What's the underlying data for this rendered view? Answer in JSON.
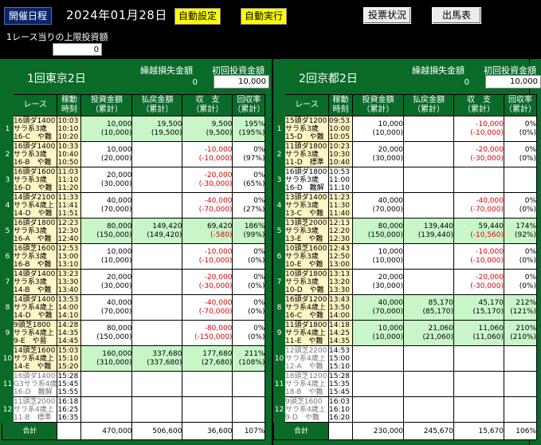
{
  "toolbar": {
    "schedule_label": "開催日程",
    "date": "2024年01月28日",
    "auto_setting": "自動設定",
    "auto_run": "自動実行",
    "vote_status": "投票状況",
    "race_card": "出馬表"
  },
  "limit": {
    "label": "1レース当りの上限投資額",
    "value": "0"
  },
  "venues": [
    {
      "name": "1回東京2日",
      "carry_label": "繰越損失金額",
      "carry_value": "0",
      "initial_label": "初回投資金額",
      "initial_value": "10,000",
      "headers": [
        "レース",
        "稼動\n時刻",
        "投資金額\n（累計）",
        "払戻金額\n（累計）",
        "収　支\n（累計）",
        "回収率\n（累計）"
      ],
      "rows": [
        {
          "no": "1",
          "race": [
            "16頭ダ1400",
            "サラ系3歳",
            "16-C　や難"
          ],
          "time": [
            "10:03",
            "10:10",
            "10:20"
          ],
          "inv": [
            "10,000",
            "(10,000)"
          ],
          "pay": [
            "19,500",
            "(19,500)"
          ],
          "bal": [
            "9,500",
            "(9,500)"
          ],
          "rate": [
            "195%",
            "(195%)"
          ],
          "state": "win"
        },
        {
          "no": "2",
          "race": [
            "16頭ダ1400",
            "サラ系3歳",
            "16-B　や難"
          ],
          "time": [
            "10:33",
            "10:40",
            "10:50"
          ],
          "inv": [
            "10,000",
            "(20,000)"
          ],
          "pay": [
            "",
            ""
          ],
          "bal": [
            "-10,000",
            "(-10,000)"
          ],
          "rate": [
            "0%",
            "(97%)"
          ],
          "state": "lose"
        },
        {
          "no": "3",
          "race": [
            "16頭ダ1600",
            "サラ系3歳",
            "16-D　や難"
          ],
          "time": [
            "11:03",
            "11:10",
            "11:20"
          ],
          "inv": [
            "20,000",
            "(30,000)"
          ],
          "pay": [
            "",
            ""
          ],
          "bal": [
            "-20,000",
            "(-30,000)"
          ],
          "rate": [
            "0%",
            "(65%)"
          ],
          "state": "lose"
        },
        {
          "no": "4",
          "race": [
            "14頭ダ2100",
            "サラ系4歳上",
            "14-D　や難"
          ],
          "time": [
            "11:33",
            "11:41",
            "11:51"
          ],
          "inv": [
            "40,000",
            "(70,000)"
          ],
          "pay": [
            "",
            ""
          ],
          "bal": [
            "-40,000",
            "(-70,000)"
          ],
          "rate": [
            "0%",
            "(27%)"
          ],
          "state": "lose"
        },
        {
          "no": "5",
          "race": [
            "16頭ダ1800",
            "サラ系3歳",
            "16-A　や難"
          ],
          "time": [
            "12:23",
            "12:30",
            "12:40"
          ],
          "inv": [
            "80,000",
            "(150,000)"
          ],
          "pay": [
            "149,420",
            "(149,420)"
          ],
          "bal": [
            "69,420",
            "(-580)"
          ],
          "rate": [
            "186%",
            "(99%)"
          ],
          "state": "win"
        },
        {
          "no": "6",
          "race": [
            "16頭芝1600",
            "サラ系3歳",
            "16-B　や難"
          ],
          "time": [
            "12:53",
            "13:00",
            "13:10"
          ],
          "inv": [
            "10,000",
            "(10,000)"
          ],
          "pay": [
            "",
            ""
          ],
          "bal": [
            "-10,000",
            "(-10,000)"
          ],
          "rate": [
            "0%",
            "(0%)"
          ],
          "state": "lose"
        },
        {
          "no": "7",
          "race": [
            "14頭ダ1400",
            "サラ系3歳",
            "14-B　や難"
          ],
          "time": [
            "13:23",
            "13:30",
            "13:40"
          ],
          "inv": [
            "20,000",
            "(30,000)"
          ],
          "pay": [
            "",
            ""
          ],
          "bal": [
            "-20,000",
            "(-30,000)"
          ],
          "rate": [
            "0%",
            "(0%)"
          ],
          "state": "lose"
        },
        {
          "no": "8",
          "race": [
            "14頭ダ1400",
            "サラ系4歳上",
            "14-D　や難"
          ],
          "time": [
            "13:53",
            "14:00",
            "14:10"
          ],
          "inv": [
            "40,000",
            "(70,000)"
          ],
          "pay": [
            "",
            ""
          ],
          "bal": [
            "-40,000",
            "(-70,000)"
          ],
          "rate": [
            "0%",
            "(0%)"
          ],
          "state": "lose"
        },
        {
          "no": "9",
          "race": [
            "9頭芝1800",
            "サラ系4歳上",
            "9-E　や易"
          ],
          "time": [
            "14:28",
            "14:35",
            "14:45"
          ],
          "inv": [
            "80,000",
            "(150,000)"
          ],
          "pay": [
            "",
            ""
          ],
          "bal": [
            "-80,000",
            "(-150,000)"
          ],
          "rate": [
            "0%",
            "(0%)"
          ],
          "state": "lose"
        },
        {
          "no": "10",
          "race": [
            "14頭芝1600",
            "サラ系4歳上",
            "14-E　や難"
          ],
          "time": [
            "15:03",
            "15:10",
            "15:20"
          ],
          "inv": [
            "160,000",
            "(310,000)"
          ],
          "pay": [
            "337,680",
            "(337,680)"
          ],
          "bal": [
            "177,680",
            "(27,680)"
          ],
          "rate": [
            "211%",
            "(108%)"
          ],
          "state": "win"
        },
        {
          "no": "11",
          "race": [
            "16頭ダ1400",
            "G3サラ系4歳",
            "16-D　難解"
          ],
          "time": [
            "15:28",
            "15:45",
            "15:55"
          ],
          "inv": [
            "",
            ""
          ],
          "pay": [
            "",
            ""
          ],
          "bal": [
            "",
            ""
          ],
          "rate": [
            "",
            ""
          ],
          "state": "past"
        },
        {
          "no": "12",
          "race": [
            "11頭芝2000",
            "サラ系4歳上",
            "11-B　標準"
          ],
          "time": [
            "16:18",
            "16:25",
            "16:35"
          ],
          "inv": [
            "",
            ""
          ],
          "pay": [
            "",
            ""
          ],
          "bal": [
            "",
            ""
          ],
          "rate": [
            "",
            ""
          ],
          "state": "past"
        }
      ],
      "total": {
        "label": "合計",
        "inv": "470,000",
        "pay": "506,600",
        "bal": "36,600",
        "rate": "107%"
      }
    },
    {
      "name": "2回京都2日",
      "carry_label": "繰越損失金額",
      "carry_value": "0",
      "initial_label": "初回投資金額",
      "initial_value": "10,000",
      "headers": [
        "レース",
        "稼動\n時刻",
        "投資金額\n（累計）",
        "払戻金額\n（累計）",
        "収　支\n（累計）",
        "回収率\n（累計）"
      ],
      "rows": [
        {
          "no": "1",
          "race": [
            "15頭ダ1200",
            "サラ系3歳",
            "15-D　や難"
          ],
          "time": [
            "09:53",
            "10:00",
            "10:05"
          ],
          "inv": [
            "10,000",
            "(10,000)"
          ],
          "pay": [
            "",
            ""
          ],
          "bal": [
            "-10,000",
            "(-10,000)"
          ],
          "rate": [
            "0%",
            "(0%)"
          ],
          "state": "lose"
        },
        {
          "no": "2",
          "race": [
            "11頭ダ1800",
            "サラ系3歳",
            "11-D　標準"
          ],
          "time": [
            "10:23",
            "10:30",
            "10:40"
          ],
          "inv": [
            "20,000",
            "(30,000)"
          ],
          "pay": [
            "",
            ""
          ],
          "bal": [
            "-20,000",
            "(-30,000)"
          ],
          "rate": [
            "0%",
            "(0%)"
          ],
          "state": "lose"
        },
        {
          "no": "3",
          "race": [
            "16頭ダ1800",
            "サラ系3歳",
            "16-D　難解"
          ],
          "time": [
            "10:53",
            "11:00",
            "11:10"
          ],
          "inv": [
            "",
            ""
          ],
          "pay": [
            "",
            ""
          ],
          "bal": [
            "",
            ""
          ],
          "rate": [
            "",
            ""
          ],
          "state": "lose"
        },
        {
          "no": "4",
          "race": [
            "13頭ダ1400",
            "サラ系3歳",
            "13-C　や難"
          ],
          "time": [
            "11:23",
            "11:30",
            "11:40"
          ],
          "inv": [
            "40,000",
            "(70,000)"
          ],
          "pay": [
            "",
            ""
          ],
          "bal": [
            "-40,000",
            "(-70,000)"
          ],
          "rate": [
            "0%",
            "(0%)"
          ],
          "state": "lose"
        },
        {
          "no": "5",
          "race": [
            "13頭芝2000",
            "サラ系3歳",
            "13-E　や難"
          ],
          "time": [
            "12:13",
            "12:20",
            "12:30"
          ],
          "inv": [
            "80,000",
            "(150,000)"
          ],
          "pay": [
            "139,440",
            "(139,440)"
          ],
          "bal": [
            "59,440",
            "(-10,560)"
          ],
          "rate": [
            "174%",
            "(92%)"
          ],
          "state": "win"
        },
        {
          "no": "6",
          "race": [
            "10頭芝1600",
            "サラ系3歳",
            "10-E　や難"
          ],
          "time": [
            "12:43",
            "12:50",
            "13:00"
          ],
          "inv": [
            "10,000",
            "(10,000)"
          ],
          "pay": [
            "",
            ""
          ],
          "bal": [
            "-10,000",
            "(-10,000)"
          ],
          "rate": [
            "0%",
            "(0%)"
          ],
          "state": "lose"
        },
        {
          "no": "7",
          "race": [
            "10頭ダ1800",
            "サラ系3歳",
            "10-D　や難"
          ],
          "time": [
            "13:13",
            "13:20",
            "13:30"
          ],
          "inv": [
            "20,000",
            "(30,000)"
          ],
          "pay": [
            "",
            ""
          ],
          "bal": [
            "-20,000",
            "(-30,000)"
          ],
          "rate": [
            "0%",
            "(0%)"
          ],
          "state": "lose"
        },
        {
          "no": "8",
          "race": [
            "16頭ダ1200",
            "サラ系4歳上",
            "16-C　や難"
          ],
          "time": [
            "13:43",
            "13:50",
            "14:00"
          ],
          "inv": [
            "40,000",
            "(70,000)"
          ],
          "pay": [
            "85,170",
            "(85,170)"
          ],
          "bal": [
            "45,170",
            "(15,170)"
          ],
          "rate": [
            "212%",
            "(121%)"
          ],
          "state": "win"
        },
        {
          "no": "9",
          "race": [
            "11頭ダ1800",
            "サラ系4歳上",
            "11-E　や難"
          ],
          "time": [
            "14:18",
            "14:25",
            "14:35"
          ],
          "inv": [
            "10,000",
            "(10,000)"
          ],
          "pay": [
            "21,060",
            "(21,060)"
          ],
          "bal": [
            "11,060",
            "(11,060)"
          ],
          "rate": [
            "210%",
            "(210%)"
          ],
          "state": "win"
        },
        {
          "no": "10",
          "race": [
            "12頭芝2200",
            "サラ系4歳上",
            "12-A　や難"
          ],
          "time": [
            "14:53",
            "15:00",
            "15:10"
          ],
          "inv": [
            "",
            ""
          ],
          "pay": [
            "",
            ""
          ],
          "bal": [
            "",
            ""
          ],
          "rate": [
            "",
            ""
          ],
          "state": "past"
        },
        {
          "no": "11",
          "race": [
            "18頭芝1200",
            "サラ系4歳上",
            "18-B　や難"
          ],
          "time": [
            "15:28",
            "15:35",
            "15:45"
          ],
          "inv": [
            "",
            ""
          ],
          "pay": [
            "",
            ""
          ],
          "bal": [
            "",
            ""
          ],
          "rate": [
            "",
            ""
          ],
          "state": "past"
        },
        {
          "no": "12",
          "race": [
            "9頭芝1600",
            "サラ系4歳上",
            "9-D　や難"
          ],
          "time": [
            "16:03",
            "16:10",
            "16:20"
          ],
          "inv": [
            "",
            ""
          ],
          "pay": [
            "",
            ""
          ],
          "bal": [
            "",
            ""
          ],
          "rate": [
            "",
            ""
          ],
          "state": "past"
        }
      ],
      "total": {
        "label": "合計",
        "inv": "230,000",
        "pay": "245,670",
        "bal": "15,670",
        "rate": "106%"
      }
    }
  ]
}
